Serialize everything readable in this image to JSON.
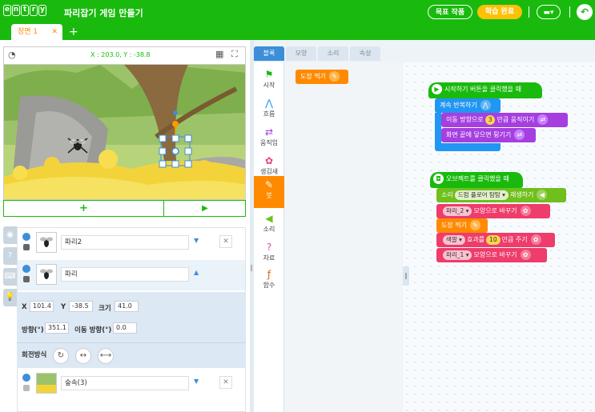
{
  "app": {
    "logo_letters": [
      "e",
      "n",
      "t",
      "r",
      "y"
    ],
    "project_title": "파리잡기 게임 만들기",
    "goal_button": "목표 작품",
    "done_button": "학습 완료",
    "accent": "#19ba0d"
  },
  "scene": {
    "tab_label": "장면 1",
    "close": "✕",
    "add": "+"
  },
  "stage": {
    "coords": "X : 203.0, Y : -38.8",
    "add_button": "+",
    "play_button": "▶"
  },
  "objects": [
    {
      "name": "파리2",
      "arrow": "▼",
      "delete": "✕"
    },
    {
      "name": "파리",
      "arrow": "▲",
      "delete": "✕"
    },
    {
      "name": "숲속(3)",
      "arrow": "▼",
      "delete": "✕"
    }
  ],
  "props": {
    "x_label": "X",
    "x_value": "101.4",
    "y_label": "Y",
    "y_value": "-38.5",
    "size_label": "크기",
    "size_value": "41.0",
    "dir_label": "방향(°)",
    "dir_value": "351.1",
    "move_label": "이동 방향(°)",
    "move_value": "0.0",
    "rotate_label": "회전방식"
  },
  "block_tabs": [
    "블록",
    "모양",
    "소리",
    "속성"
  ],
  "categories": [
    {
      "label": "시작",
      "icon": "⚑",
      "color": "#19ba0d"
    },
    {
      "label": "흐름",
      "icon": "⋀",
      "color": "#2196f3"
    },
    {
      "label": "움직임",
      "icon": "⇄",
      "color": "#a53fe0"
    },
    {
      "label": "생김새",
      "icon": "✿",
      "color": "#ee3c6b"
    },
    {
      "label": "붓",
      "icon": "✎",
      "color": "#ffffff"
    },
    {
      "label": "소리",
      "icon": "◀",
      "color": "#6fbf1d"
    },
    {
      "label": "자료",
      "icon": "?",
      "color": "#e14cb3"
    },
    {
      "label": "함수",
      "icon": "ƒ",
      "color": "#e65a1f"
    }
  ],
  "palette_block": "도장 찍기",
  "script1": {
    "hat": "시작하기 버튼을 클릭했을 때",
    "loop": "계속 반복하기",
    "move1": "이동 방향으로",
    "move_value": "3",
    "move2": "만큼 움직이기",
    "bounce": "화면 끝에 닿으면 튕기기"
  },
  "script2": {
    "hat": "오브젝트를 클릭했을 때",
    "sound1": "소리",
    "sound_value": "드럼 플로어 탐탐 ▾",
    "sound2": "재생하기",
    "shape_a": "파리_2 ▾",
    "shape_a2": "모양으로 바꾸기",
    "stamp": "도장 찍기",
    "effect_value": "색깔 ▾",
    "effect1": "효과를",
    "effect_amount": "10",
    "effect2": "만큼 주기",
    "shape_b": "파리_1 ▾",
    "shape_b2": "모양으로 바꾸기"
  }
}
